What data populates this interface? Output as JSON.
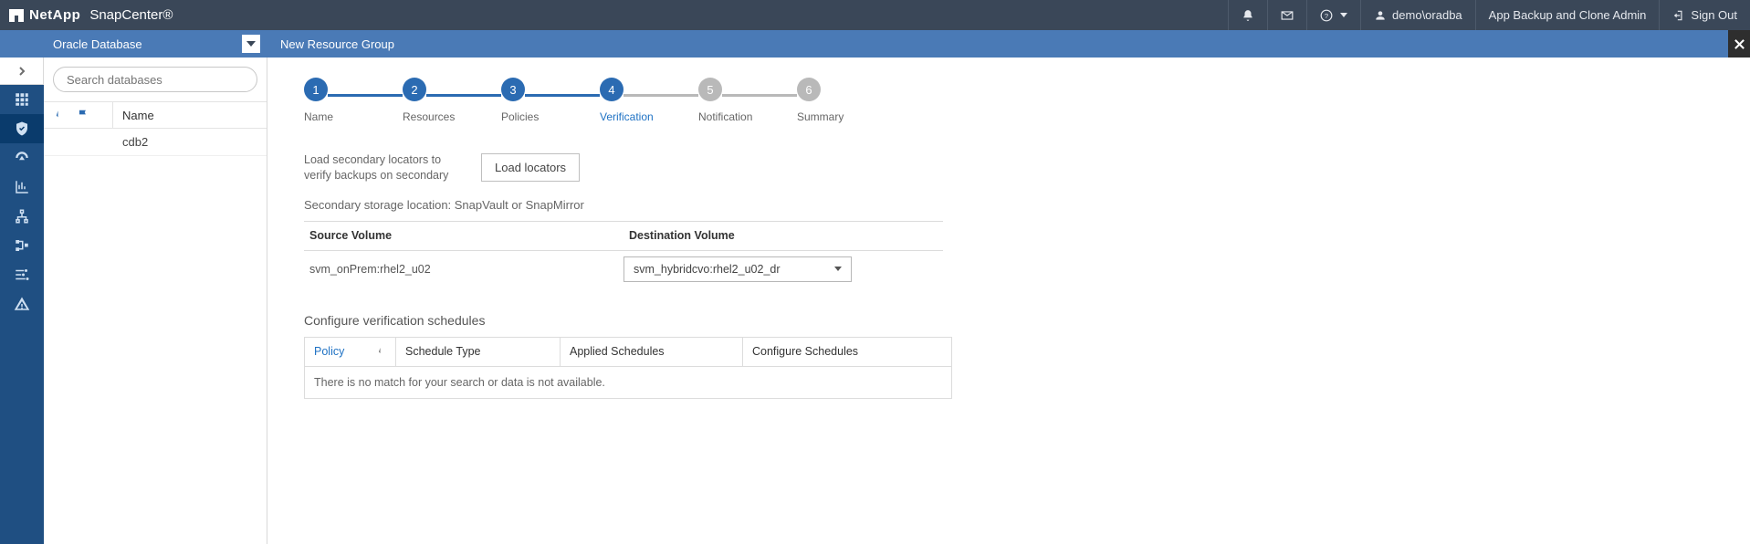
{
  "brand": {
    "vendor": "NetApp",
    "product": "SnapCenter®"
  },
  "topbar": {
    "user": "demo\\oradba",
    "role": "App Backup and Clone Admin",
    "signout": "Sign Out"
  },
  "resource": {
    "type": "Oracle Database",
    "page_title": "New Resource Group"
  },
  "search": {
    "placeholder": "Search databases"
  },
  "list": {
    "header_name": "Name",
    "rows": [
      "cdb2"
    ]
  },
  "wizard_steps": [
    {
      "num": "1",
      "label": "Name"
    },
    {
      "num": "2",
      "label": "Resources"
    },
    {
      "num": "3",
      "label": "Policies"
    },
    {
      "num": "4",
      "label": "Verification"
    },
    {
      "num": "5",
      "label": "Notification"
    },
    {
      "num": "6",
      "label": "Summary"
    }
  ],
  "verification": {
    "load_text": "Load secondary locators to verify backups on secondary",
    "load_button": "Load locators",
    "storage_title": "Secondary storage location: SnapVault or SnapMirror",
    "col_source": "Source Volume",
    "col_dest": "Destination Volume",
    "source_value": "svm_onPrem:rhel2_u02",
    "dest_value": "svm_hybridcvo:rhel2_u02_dr",
    "cfg_title": "Configure verification schedules",
    "grid": {
      "policy": "Policy",
      "schedule_type": "Schedule Type",
      "applied": "Applied Schedules",
      "configure": "Configure Schedules",
      "empty": "There is no match for your search or data is not available."
    }
  }
}
